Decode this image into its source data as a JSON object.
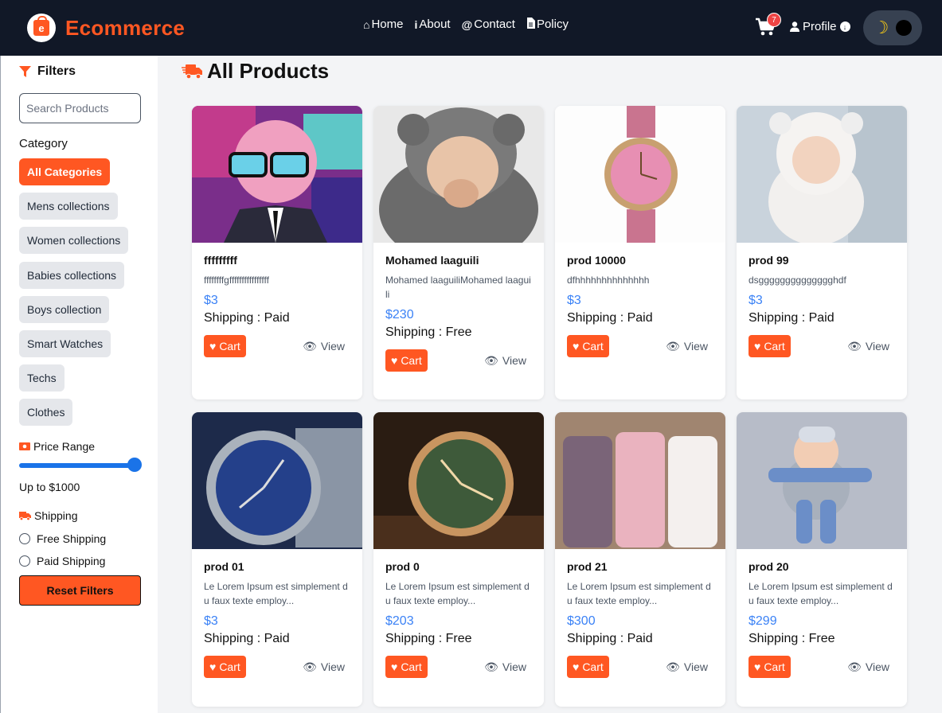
{
  "header": {
    "logo_letter": "e",
    "brand": "Ecommerce",
    "nav": [
      {
        "label": "Home",
        "icon": "home-icon"
      },
      {
        "label": "About",
        "icon": "info-icon"
      },
      {
        "label": "Contact",
        "icon": "at-icon"
      },
      {
        "label": "Policy",
        "icon": "file-icon"
      }
    ],
    "cart_count": "7",
    "profile_label": "Profile"
  },
  "sidebar": {
    "title": "Filters",
    "search_placeholder": "Search Products",
    "category_label": "Category",
    "categories": [
      "All Categories",
      "Mens collections",
      "Women collections",
      "Babies collections",
      "Boys collection",
      "Smart Watches",
      "Techs",
      "Clothes"
    ],
    "active_category": "All Categories",
    "price_label": "Price Range",
    "price_value": "Up to $1000",
    "price_fraction": 1.0,
    "shipping_label": "Shipping",
    "shipping_options": [
      "Free Shipping",
      "Paid Shipping"
    ],
    "reset_label": "Reset Filters"
  },
  "main": {
    "title": "All Products",
    "cart_label": "Cart",
    "view_label": "View",
    "products": [
      {
        "name": "fffffffff",
        "desc": "ffffffffgffffffffffffffff",
        "price": "$3",
        "shipping": "Shipping : Paid"
      },
      {
        "name": "Mohamed laaguili",
        "desc": "Mohamed laaguiliMohamed laaguili",
        "price": "$230",
        "shipping": "Shipping : Free"
      },
      {
        "name": "prod 10000",
        "desc": "dfhhhhhhhhhhhhhh",
        "price": "$3",
        "shipping": "Shipping : Paid"
      },
      {
        "name": "prod 99",
        "desc": "dsgggggggggggggghdf",
        "price": "$3",
        "shipping": "Shipping : Paid"
      },
      {
        "name": "prod 01",
        "desc": "Le Lorem Ipsum est simplement du faux texte employ...",
        "price": "$3",
        "shipping": "Shipping : Paid"
      },
      {
        "name": "prod 0",
        "desc": "Le Lorem Ipsum est simplement du faux texte employ...",
        "price": "$203",
        "shipping": "Shipping : Free"
      },
      {
        "name": "prod 21",
        "desc": "Le Lorem Ipsum est simplement du faux texte employ...",
        "price": "$300",
        "shipping": "Shipping : Paid"
      },
      {
        "name": "prod 20",
        "desc": "Le Lorem Ipsum est simplement du faux texte employ...",
        "price": "$299",
        "shipping": "Shipping : Free"
      }
    ]
  },
  "colors": {
    "accent": "#ff5722",
    "header_bg": "#111827",
    "price": "#3b82f6",
    "slider": "#1a73e8"
  }
}
